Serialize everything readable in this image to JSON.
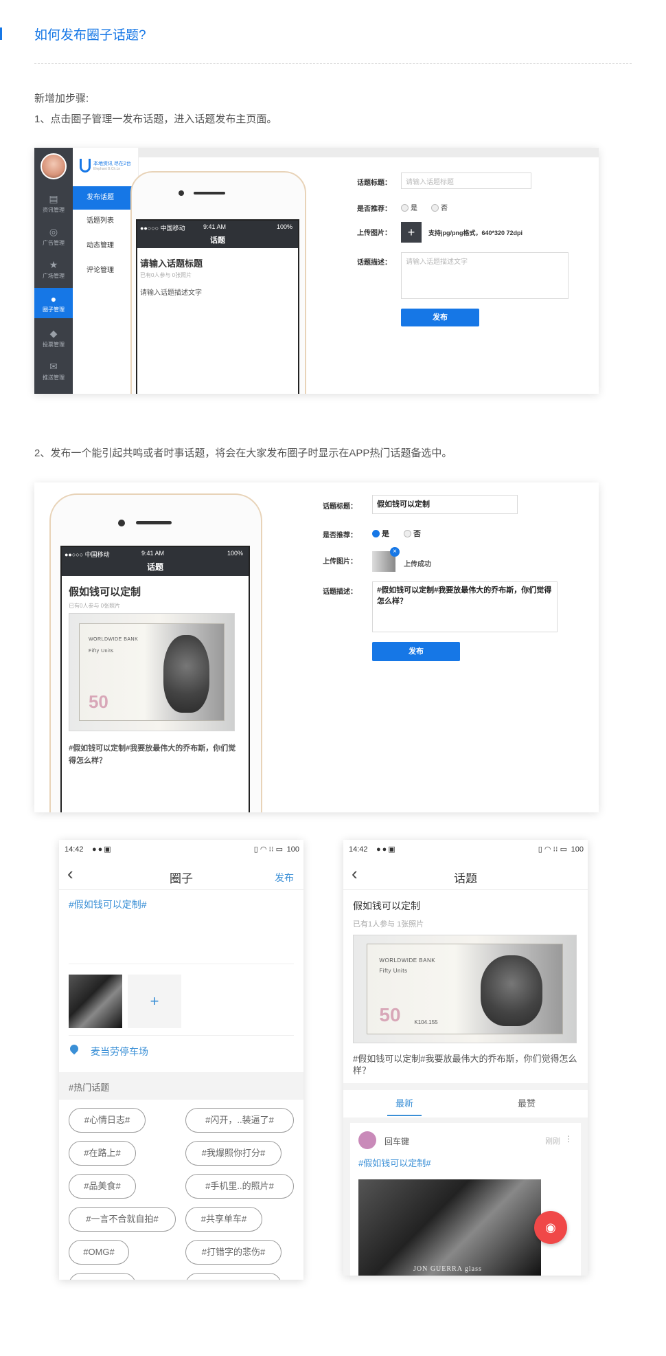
{
  "header": {
    "title": "如何发布圈子话题?",
    "intro": "新增加步骤:",
    "step1": "1、点击圈子管理一发布话题，进入话题发布主页面。",
    "step2": "2、发布一个能引起共鸣或者时事话题，将会在大家发布圈子时显示在APP热门话题备选中。"
  },
  "admin": {
    "logo_text": "本地资讯 尽在2台",
    "logo_sub": "Elephant B.Ch.Ln",
    "side_items": [
      "资讯管理",
      "广告管理",
      "广场管理",
      "圈子管理",
      "投票管理",
      "推送管理"
    ],
    "side_icons": [
      "doc-icon",
      "target-icon",
      "star-icon",
      "chat-bubble-icon",
      "dropbox-icon",
      "envelope-icon"
    ],
    "menu_items": [
      "发布话题",
      "话题列表",
      "动态管理",
      "评论管理"
    ]
  },
  "phone": {
    "carrier": "●●○○○ 中国移动",
    "time": "9:41 AM",
    "battery": "100%",
    "screen_title": "话题"
  },
  "form1": {
    "title_label": "话题标题：",
    "title_placeholder": "请输入话题标题",
    "recommend_label": "是否推荐：",
    "yes": "是",
    "no": "否",
    "upload_label": "上传图片：",
    "upload_hint": "支持jpg/png格式，640*320 72dpi",
    "desc_label": "话题描述：",
    "desc_placeholder": "请输入话题描述文字",
    "submit": "发布",
    "preview_title": "请输入话题标题",
    "preview_meta": "已有0人参与 0张照片",
    "preview_desc": "请输入话题描述文字"
  },
  "form2": {
    "title_label": "话题标题：",
    "title_value": "假如钱可以定制",
    "recommend_label": "是否推荐：",
    "yes": "是",
    "no": "否",
    "upload_label": "上传图片：",
    "upload_status": "上传成功",
    "desc_label": "话题描述：",
    "desc_value": "#假如钱可以定制#我要放最伟大的乔布斯，你们觉得怎么样？",
    "submit": "发布",
    "preview_title": "假如钱可以定制",
    "preview_meta": "已有0人参与 0张照片",
    "preview_desc": "#假如钱可以定制#我要放最伟大的乔布斯，你们觉得怎么样？"
  },
  "banknote": {
    "bank": "WORLDWIDE BANK",
    "units": "Fifty Units",
    "number": "50",
    "serial": "K104.155"
  },
  "circle_screen": {
    "status_time": "14:42",
    "status_right": "100",
    "title": "圈子",
    "action": "发布",
    "topic_tag": "#假如钱可以定制#",
    "add_icon": "+",
    "location": "麦当劳停车场",
    "hot_header": "#热门话题",
    "hot_tags": [
      "#心情日志#",
      "#闪开，..装逼了#",
      "#在路上#",
      "#我爆照你打分#",
      "#品美食#",
      "#手机里..的照片#",
      "#一言不合就自拍#",
      "#共享单车#",
      "#OMG#",
      "#打错字的悲伤#"
    ]
  },
  "topic_screen": {
    "status_time": "14:42",
    "status_right": "100",
    "title": "话题",
    "topic_title": "假如钱可以定制",
    "meta": "已有1人参与 1张照片",
    "desc": "#假如钱可以定制#我要放最伟大的乔布斯，你们觉得怎么样？",
    "tabs": [
      "最新",
      "最赞"
    ],
    "post_user": "回车键",
    "post_time": "刚刚",
    "post_tag": "#假如钱可以定制#",
    "photo_caption": "JON GUERRA glass"
  },
  "colors": {
    "accent": "#1677e6",
    "mobile_blue": "#3a8fd6",
    "fab_red": "#f04848"
  }
}
